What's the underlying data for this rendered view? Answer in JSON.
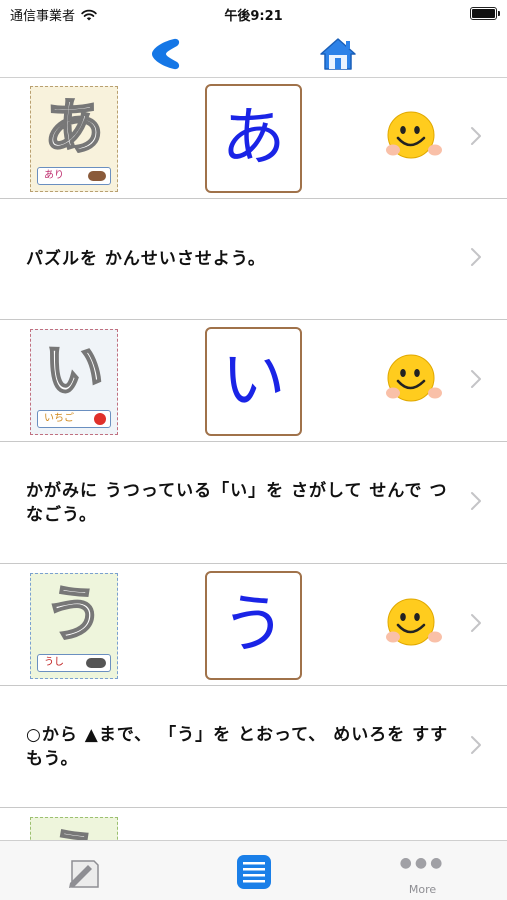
{
  "status_bar": {
    "carrier": "通信事業者",
    "time": "午後9:21"
  },
  "nav": {
    "back_icon": "chevron-left-icon",
    "home_icon": "house-icon"
  },
  "rows": [
    {
      "type": "card",
      "thumb_char": "あ",
      "thumb_word": "あり",
      "letter": "あ",
      "icon": "smiley-face-icon"
    },
    {
      "type": "text",
      "text": "パズルを かんせいさせよう。"
    },
    {
      "type": "card",
      "thumb_char": "い",
      "thumb_word": "いちご",
      "letter": "い",
      "icon": "smiley-face-icon"
    },
    {
      "type": "text",
      "text": "かがみに うつっている「い」を さがして せんで つなごう。"
    },
    {
      "type": "card",
      "thumb_char": "う",
      "thumb_word": "うし",
      "letter": "う",
      "icon": "smiley-face-icon"
    },
    {
      "type": "text",
      "text": "○から ▲まで、 「う」を とおって、 めいろを すすもう。"
    },
    {
      "type": "card",
      "thumb_char": "え",
      "thumb_word": "",
      "letter": "",
      "icon": ""
    }
  ],
  "tabs": {
    "items": [
      {
        "icon": "pencil-paper-icon"
      },
      {
        "icon": "list-icon"
      },
      {
        "icon": "more-dots-icon",
        "label": "More"
      }
    ],
    "selected_index": 1,
    "accent": "#1a7fe8"
  }
}
